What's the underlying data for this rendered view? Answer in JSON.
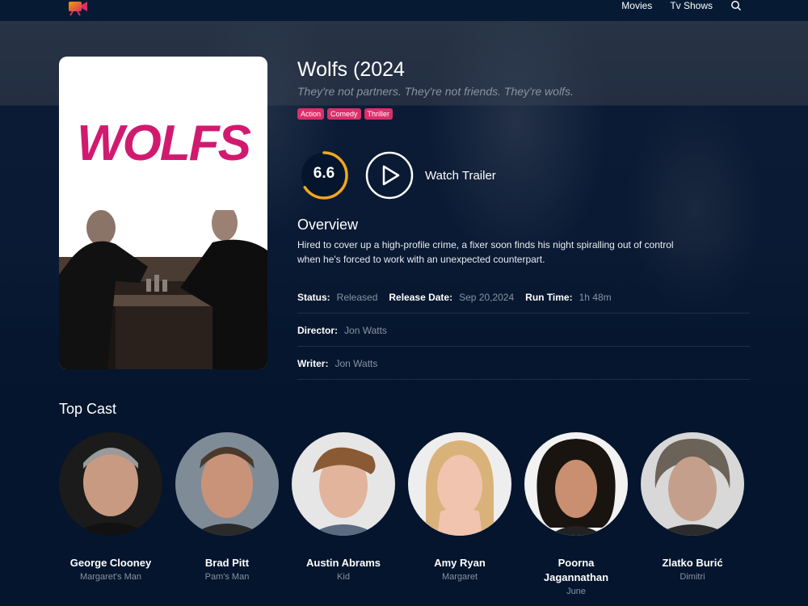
{
  "nav": {
    "movies": "Movies",
    "tv_shows": "Tv Shows"
  },
  "movie": {
    "title": "Wolfs (2024",
    "tagline": "They're not partners. They're not friends. They're wolfs.",
    "genres": [
      "Action",
      "Comedy",
      "Thriller"
    ],
    "rating": "6.6",
    "rating_fraction": 0.66,
    "watch_trailer": "Watch Trailer",
    "overview_heading": "Overview",
    "overview": "Hired to cover up a high-profile crime, a fixer soon finds his night spiralling out of control when he's forced to work with an unexpected counterpart.",
    "poster_title": "WOLFS",
    "status_label": "Status:",
    "status": "Released",
    "release_label": "Release Date:",
    "release_date": "Sep 20,2024",
    "runtime_label": "Run Time:",
    "runtime": "1h 48m",
    "director_label": "Director:",
    "director": "Jon Watts",
    "writer_label": "Writer:",
    "writer": "Jon Watts"
  },
  "cast_heading": "Top Cast",
  "cast": [
    {
      "name": "George Clooney",
      "character": "Margaret's Man"
    },
    {
      "name": "Brad Pitt",
      "character": "Pam's Man"
    },
    {
      "name": "Austin Abrams",
      "character": "Kid"
    },
    {
      "name": "Amy Ryan",
      "character": "Margaret"
    },
    {
      "name": "Poorna Jagannathan",
      "character": "June"
    },
    {
      "name": "Zlatko Burić",
      "character": "Dimitri"
    }
  ],
  "colors": {
    "accent": "#da2f68",
    "rating_ring": "#f0a81c",
    "background": "#04152d"
  }
}
